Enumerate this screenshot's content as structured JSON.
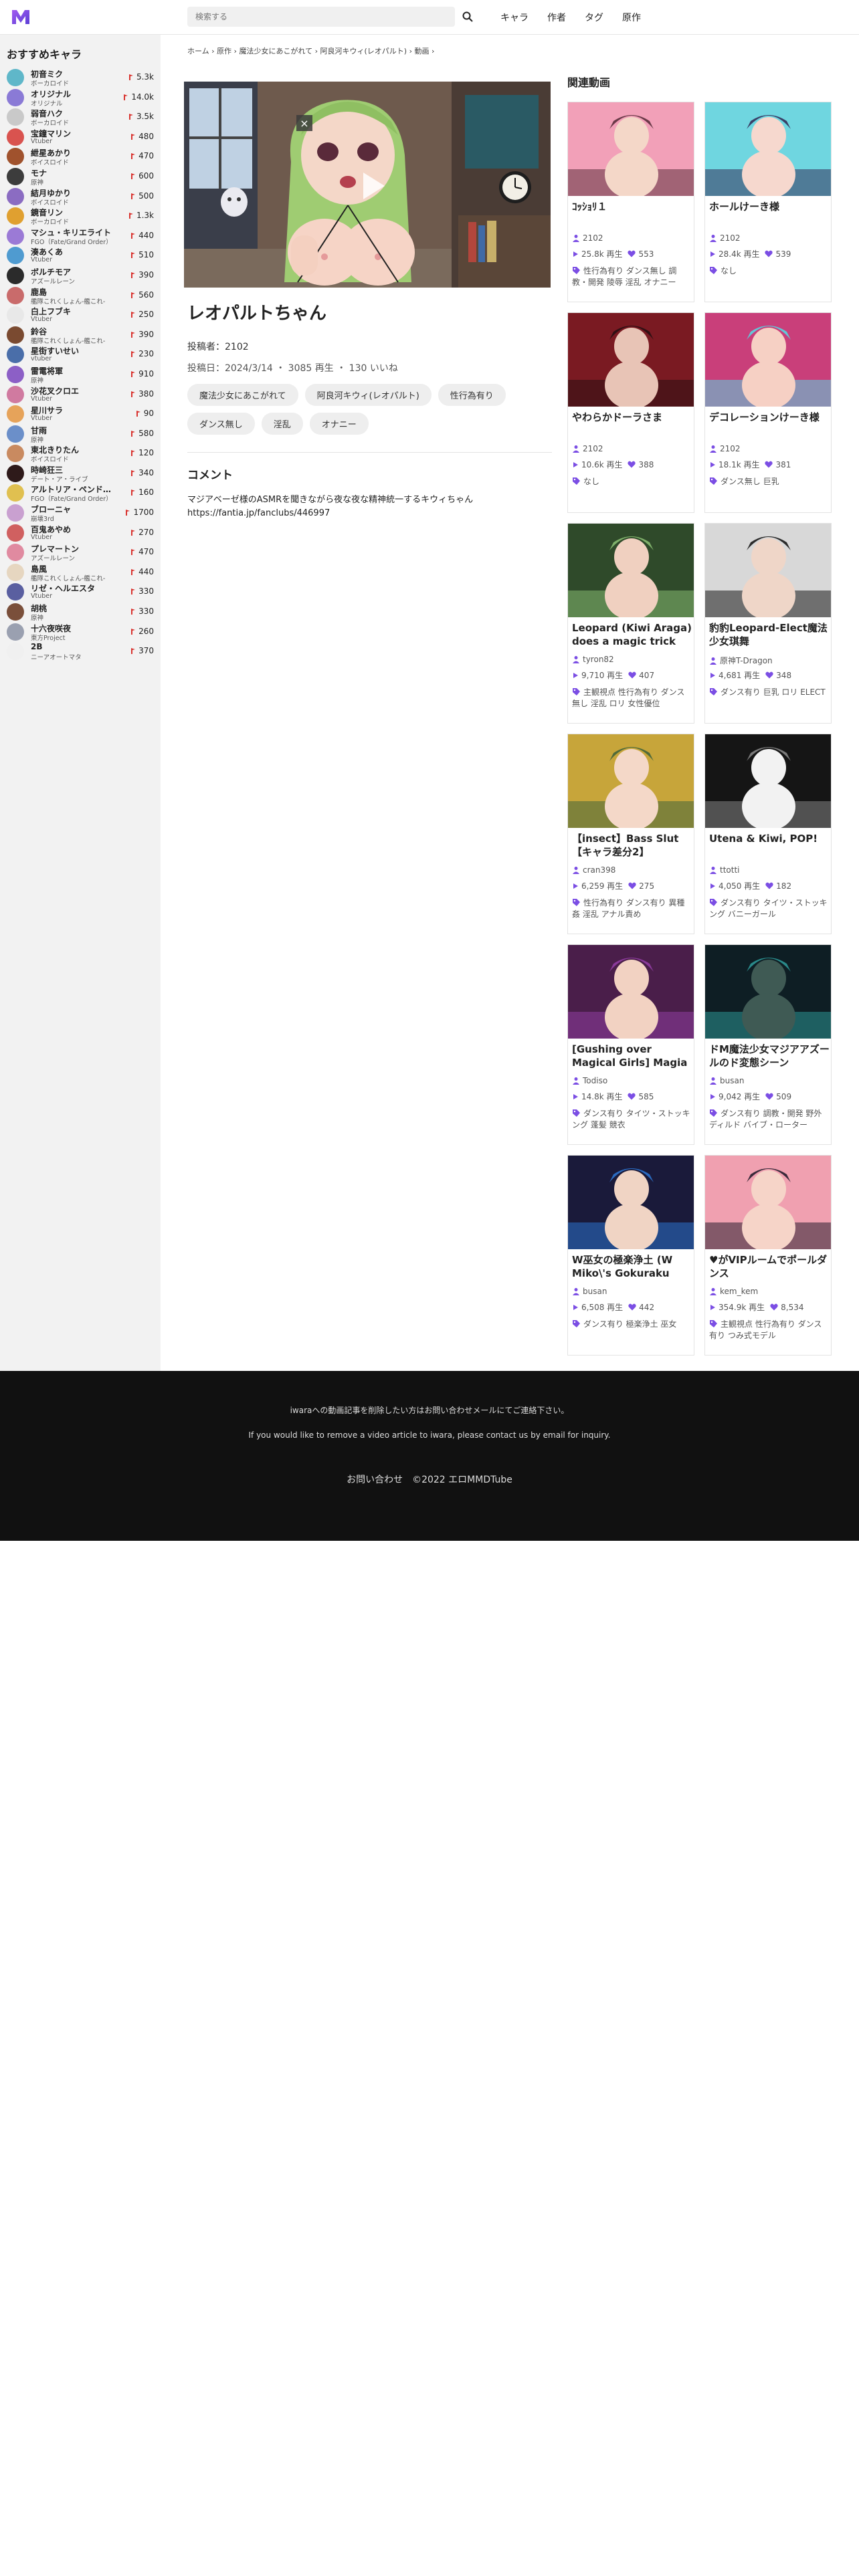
{
  "header": {
    "search_placeholder": "検索する",
    "nav": [
      "キャラ",
      "作者",
      "タグ",
      "原作"
    ],
    "brand_color": "#7b4ee4"
  },
  "sidebar": {
    "title": "おすすめキャラ",
    "items": [
      {
        "name": "初音ミク",
        "sub": "ボーカロイド",
        "count": "5.3k"
      },
      {
        "name": "オリジナル",
        "sub": "オリジナル",
        "count": "14.0k"
      },
      {
        "name": "弱音ハク",
        "sub": "ボーカロイド",
        "count": "3.5k"
      },
      {
        "name": "宝鐘マリン",
        "sub": "Vtuber",
        "count": "480"
      },
      {
        "name": "紲星あかり",
        "sub": "ボイスロイド",
        "count": "470"
      },
      {
        "name": "モナ",
        "sub": "原神",
        "count": "600"
      },
      {
        "name": "結月ゆかり",
        "sub": "ボイスロイド",
        "count": "500"
      },
      {
        "name": "鏡音リン",
        "sub": "ボーカロイド",
        "count": "1.3k"
      },
      {
        "name": "マシュ・キリエライト",
        "sub": "FGO（Fate/Grand Order）",
        "count": "440"
      },
      {
        "name": "湊あくあ",
        "sub": "Vtuber",
        "count": "510"
      },
      {
        "name": "ボルチモア",
        "sub": "アズールレーン",
        "count": "390"
      },
      {
        "name": "鹿島",
        "sub": "艦隊これくしょん-艦これ-",
        "count": "560"
      },
      {
        "name": "白上フブキ",
        "sub": "Vtuber",
        "count": "250"
      },
      {
        "name": "鈴谷",
        "sub": "艦隊これくしょん-艦これ-",
        "count": "390"
      },
      {
        "name": "星街すいせい",
        "sub": "vtuber",
        "count": "230"
      },
      {
        "name": "雷電将軍",
        "sub": "原神",
        "count": "910"
      },
      {
        "name": "沙花叉クロエ",
        "sub": "Vtuber",
        "count": "380"
      },
      {
        "name": "星川サラ",
        "sub": "Vtuber",
        "count": "90"
      },
      {
        "name": "甘雨",
        "sub": "原神",
        "count": "580"
      },
      {
        "name": "東北きりたん",
        "sub": "ボイスロイド",
        "count": "120"
      },
      {
        "name": "時崎狂三",
        "sub": "デート・ア・ライブ",
        "count": "340"
      },
      {
        "name": "アルトリア・ペンドラゴン",
        "sub": "FGO（Fate/Grand Order）",
        "count": "160"
      },
      {
        "name": "ブローニャ",
        "sub": "崩壊3rd",
        "count": "1700"
      },
      {
        "name": "百鬼あやめ",
        "sub": "Vtuber",
        "count": "270"
      },
      {
        "name": "プレマートン",
        "sub": "アズールレーン",
        "count": "470"
      },
      {
        "name": "島風",
        "sub": "艦隊これくしょん-艦これ-",
        "count": "440"
      },
      {
        "name": "リゼ・ヘルエスタ",
        "sub": "Vtuber",
        "count": "330"
      },
      {
        "name": "胡桃",
        "sub": "原神",
        "count": "330"
      },
      {
        "name": "十六夜咲夜",
        "sub": "東方Project",
        "count": "260"
      },
      {
        "name": "2B",
        "sub": "ニーアオートマタ",
        "count": "370"
      }
    ]
  },
  "breadcrumb": "ホーム › 原作 › 魔法少女にあこがれて › 阿良河キウィ(レオパルト) › 動画 ›",
  "video": {
    "title": "レオパルトちゃん",
    "poster_label": "投稿者：",
    "poster": "2102",
    "posted": "投稿日：2024/3/14 ・ 3085 再生 ・ 130 いいね",
    "tags": [
      "魔法少女にあこがれて",
      "阿良河キウィ(レオパルト)",
      "性行為有り",
      "ダンス無し",
      "淫乱",
      "オナニー"
    ],
    "close_glyph": "×"
  },
  "comments": {
    "heading": "コメント",
    "description": "マジアベーゼ様のASMRを聞きながら夜な夜な精神統一するキウィちゃん",
    "link": "https://fantia.jp/fanclubs/446997"
  },
  "related": {
    "title": "関連動画",
    "cards": [
      {
        "title": "ｺｯｼｮﾘ１",
        "author": "2102",
        "views": "25.8k 再生",
        "likes": "553",
        "tags": "性行為有り ダンス無し 調教・開発 陵辱 淫乱 オナニー"
      },
      {
        "title": "ホールけーき様",
        "author": "2102",
        "views": "28.4k 再生",
        "likes": "539",
        "tags": "なし"
      },
      {
        "title": "やわらかドーラさま",
        "author": "2102",
        "views": "10.6k 再生",
        "likes": "388",
        "tags": "なし"
      },
      {
        "title": "デコレーションけーき様",
        "author": "2102",
        "views": "18.1k 再生",
        "likes": "381",
        "tags": "ダンス無し 巨乳"
      },
      {
        "title": "Leopard (Kiwi Araga) does a magic trick",
        "author": "tyron82",
        "views": "9,710 再生",
        "likes": "407",
        "tags": "主観視点 性行為有り ダンス無し 淫乱 ロリ 女性優位"
      },
      {
        "title": "豹豹Leopard-Elect魔法少女琪舞",
        "author": "原神T-Dragon",
        "views": "4,681 再生",
        "likes": "348",
        "tags": "ダンス有り 巨乳 ロリ ELECT"
      },
      {
        "title": "【insect】Bass Slut【キャラ差分2】",
        "author": "cran398",
        "views": "6,259 再生",
        "likes": "275",
        "tags": "性行為有り ダンス有り 異種姦 淫乱 アナル責め"
      },
      {
        "title": "Utena & Kiwi, POP!",
        "author": "ttotti",
        "views": "4,050 再生",
        "likes": "182",
        "tags": "ダンス有り タイツ・ストッキング バニーガール"
      },
      {
        "title": "[Gushing over Magical Girls] Magia Baiser",
        "author": "Todiso",
        "views": "14.8k 再生",
        "likes": "585",
        "tags": "ダンス有り タイツ・ストッキング 蓬髪 競衣"
      },
      {
        "title": "ドM魔法少女マジアアズールのド変態シーン",
        "author": "busan",
        "views": "9,042 再生",
        "likes": "509",
        "tags": "ダンス有り 調教・開発 野外 ディルド バイブ・ローター"
      },
      {
        "title": "W巫女の極楽浄土 (W Miko\\'s Gokuraku Jodo)",
        "author": "busan",
        "views": "6,508 再生",
        "likes": "442",
        "tags": "ダンス有り 極楽浄土 巫女"
      },
      {
        "title": "♥がVIPルームでポールダンス",
        "author": "kem_kem",
        "views": "354.9k 再生",
        "likes": "8,534",
        "tags": "主観視点 性行為有り ダンス有り つみ式モデル"
      }
    ]
  },
  "footer": {
    "line1": "iwaraへの動画記事を削除したい方はお問い合わせメールにてご連絡下さい。",
    "line2": "If you would like to remove a video article to iwara, please contact us by email for inquiry.",
    "line3": "お問い合わせ　©2022 エロMMDTube"
  }
}
